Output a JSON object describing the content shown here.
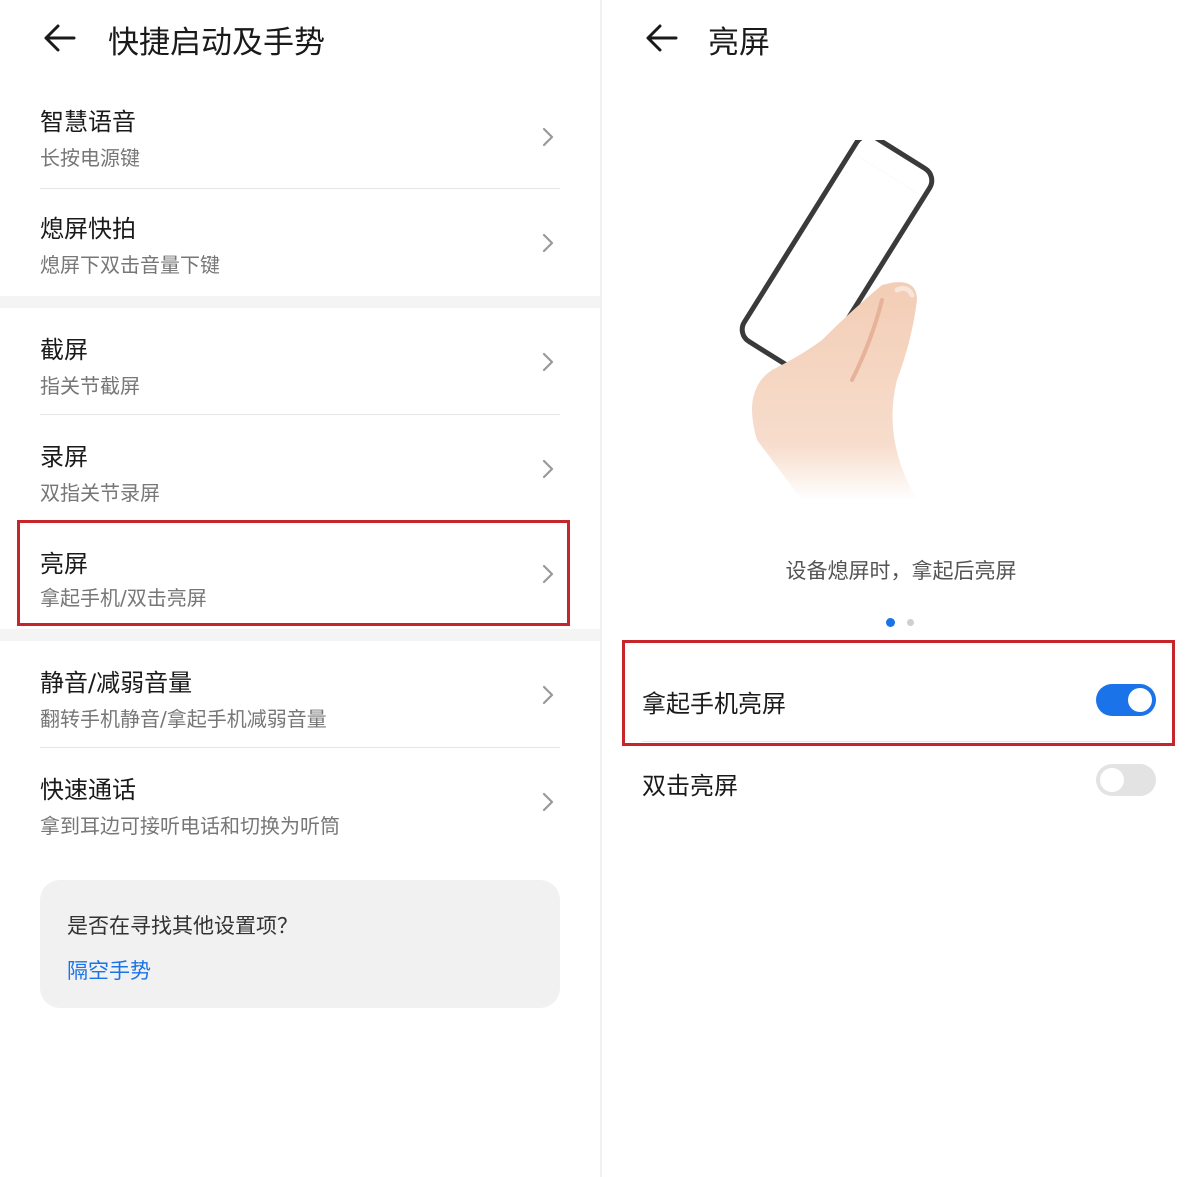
{
  "left": {
    "title": "快捷启动及手势",
    "items": [
      {
        "label": "智慧语音",
        "sub": "长按电源键"
      },
      {
        "label": "熄屏快拍",
        "sub": "熄屏下双击音量下键"
      },
      {
        "label": "截屏",
        "sub": "指关节截屏"
      },
      {
        "label": "录屏",
        "sub": "双指关节录屏"
      },
      {
        "label": "亮屏",
        "sub": "拿起手机/双击亮屏"
      },
      {
        "label": "静音/减弱音量",
        "sub": "翻转手机静音/拿起手机减弱音量"
      },
      {
        "label": "快速通话",
        "sub": "拿到耳边可接听电话和切换为听筒"
      }
    ],
    "card": {
      "question": "是否在寻找其他设置项？",
      "link": "隔空手势"
    }
  },
  "right": {
    "title": "亮屏",
    "caption": "设备熄屏时，拿起后亮屏",
    "page_indicator": {
      "count": 2,
      "active": 1
    },
    "switches": [
      {
        "label": "拿起手机亮屏",
        "on": true
      },
      {
        "label": "双击亮屏",
        "on": false
      }
    ]
  },
  "colors": {
    "accent": "#1a73e8",
    "highlight": "#c6252b",
    "toggle_off": "#e3e3e3"
  }
}
